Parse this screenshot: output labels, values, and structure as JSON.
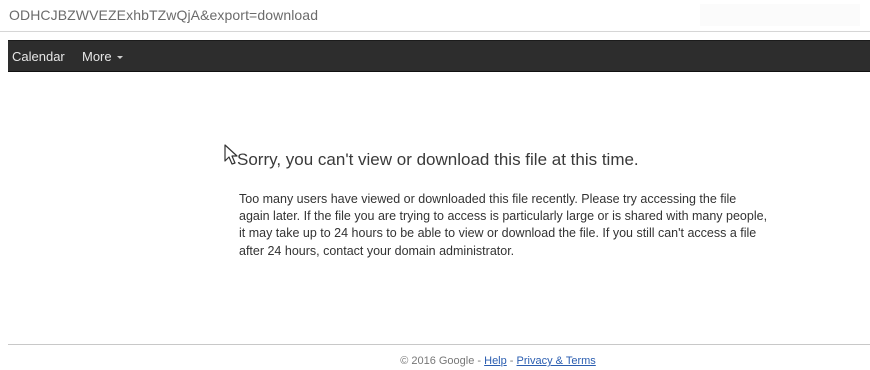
{
  "browser": {
    "address_text": "ODHCJBZWVEZExhbTZwQjA&export=download"
  },
  "navbar": {
    "background": "#2d2d2d",
    "items": [
      {
        "label": "Calendar"
      },
      {
        "label": "More",
        "icon": "caret-down-icon"
      }
    ]
  },
  "error": {
    "heading": "Sorry, you can't view or download this file at this time.",
    "message": "Too many users have viewed or downloaded this file recently. Please try accessing the file again later. If the file you are trying to access is particularly large or is shared with many people, it may take up to 24 hours to be able to view or download the file. If you still can't access a file after 24 hours, contact your domain administrator."
  },
  "footer": {
    "copyright": "© 2016 Google - ",
    "separator": " - ",
    "help_label": "Help",
    "privacy_label": "Privacy & Terms",
    "link_color": "#2a5db0"
  }
}
